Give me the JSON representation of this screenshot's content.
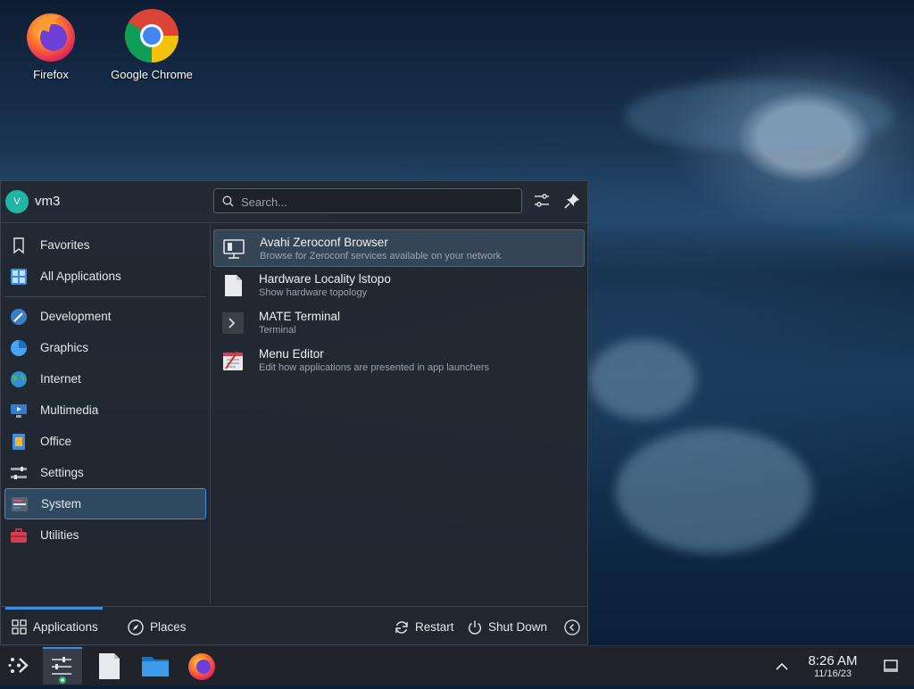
{
  "desktop": {
    "icons": [
      {
        "label": "Firefox"
      },
      {
        "label": "Google Chrome"
      }
    ]
  },
  "menu": {
    "user": {
      "name": "vm3",
      "initial": "V"
    },
    "search": {
      "placeholder": "Search..."
    },
    "sidebar": [
      {
        "label": "Favorites",
        "icon": "bookmark-icon"
      },
      {
        "label": "All Applications",
        "icon": "grid-icon"
      },
      {
        "label": "Development",
        "icon": "development-icon"
      },
      {
        "label": "Graphics",
        "icon": "graphics-icon"
      },
      {
        "label": "Internet",
        "icon": "globe-icon"
      },
      {
        "label": "Multimedia",
        "icon": "multimedia-icon"
      },
      {
        "label": "Office",
        "icon": "office-icon"
      },
      {
        "label": "Settings",
        "icon": "settings-icon"
      },
      {
        "label": "System",
        "icon": "system-icon",
        "active": true
      },
      {
        "label": "Utilities",
        "icon": "utilities-icon"
      }
    ],
    "apps": [
      {
        "name": "Avahi Zeroconf Browser",
        "desc": "Browse for Zeroconf services available on your network",
        "icon": "network-icon"
      },
      {
        "name": "Hardware Locality lstopo",
        "desc": "Show hardware topology",
        "icon": "document-icon"
      },
      {
        "name": "MATE Terminal",
        "desc": "Terminal",
        "icon": "terminal-icon"
      },
      {
        "name": "Menu Editor",
        "desc": "Edit how applications are presented in app launchers",
        "icon": "menu-editor-icon"
      }
    ],
    "footer": {
      "applications": "Applications",
      "places": "Places",
      "restart": "Restart",
      "shutdown": "Shut Down"
    }
  },
  "taskbar": {
    "time": "8:26 AM",
    "date": "11/16/23"
  },
  "colors": {
    "accent": "#3d8ee0",
    "menu_bg": "#222830",
    "taskbar_bg": "#20242a"
  }
}
